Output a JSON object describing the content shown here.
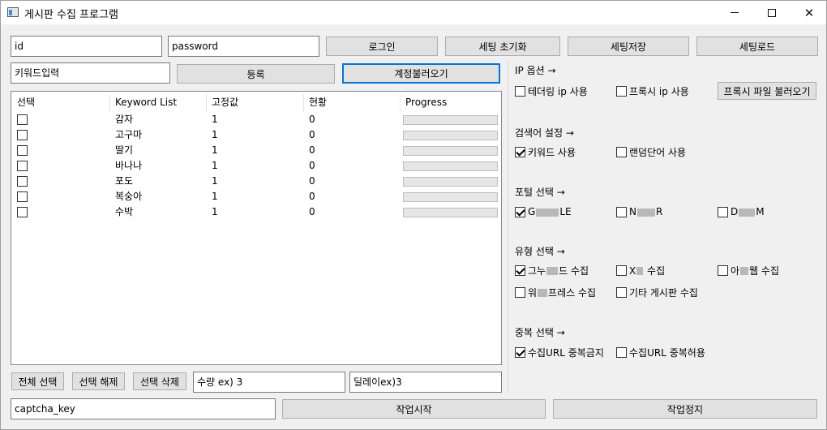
{
  "window": {
    "title": "게시판 수집 프로그램"
  },
  "login": {
    "id_value": "id",
    "password_value": "password",
    "login_label": "로그인",
    "reset_label": "세팅 초기화",
    "save_label": "세팅저장",
    "load_label": "세팅로드"
  },
  "keyword": {
    "input_value": "키워드입력",
    "register_label": "등록",
    "load_accounts_label": "계정불러오기"
  },
  "table": {
    "columns": [
      "선택",
      "Keyword List",
      "고정값",
      "현황",
      "Progress"
    ],
    "rows": [
      {
        "checked": false,
        "keyword": "감자",
        "fixed": "1",
        "status": "0",
        "progress": 0
      },
      {
        "checked": false,
        "keyword": "고구마",
        "fixed": "1",
        "status": "0",
        "progress": 0
      },
      {
        "checked": false,
        "keyword": "딸기",
        "fixed": "1",
        "status": "0",
        "progress": 0
      },
      {
        "checked": false,
        "keyword": "바나나",
        "fixed": "1",
        "status": "0",
        "progress": 0
      },
      {
        "checked": false,
        "keyword": "포도",
        "fixed": "1",
        "status": "0",
        "progress": 0
      },
      {
        "checked": false,
        "keyword": "복숭아",
        "fixed": "1",
        "status": "0",
        "progress": 0
      },
      {
        "checked": false,
        "keyword": "수박",
        "fixed": "1",
        "status": "0",
        "progress": 0
      }
    ]
  },
  "bottom": {
    "select_all_label": "전체 선택",
    "deselect_label": "선택 해제",
    "delete_selected_label": "선택 삭제",
    "quantity_value": "수량 ex) 3",
    "delay_value": "딜레이ex)3",
    "captcha_value": "captcha_key",
    "start_label": "작업시작",
    "stop_label": "작업정지"
  },
  "options": {
    "ip": {
      "title": "IP 옵션 →",
      "tethering": {
        "label": "테더링 ip 사용",
        "checked": false
      },
      "proxy": {
        "label": "프록시 ip 사용",
        "checked": false
      },
      "load_proxy_label": "프록시 파일 불러오기"
    },
    "search": {
      "title": "검색어 설정 →",
      "keyword": {
        "label": "키워드 사용",
        "checked": true
      },
      "random": {
        "label": "랜덤단어 사용",
        "checked": false
      }
    },
    "portal": {
      "title": "포털 선택 →",
      "google": {
        "label_a": "G",
        "label_b": "LE",
        "checked": true
      },
      "naver": {
        "label_a": "N",
        "label_b": "R",
        "checked": false
      },
      "daum": {
        "label_a": "D",
        "label_b": "M",
        "checked": false
      }
    },
    "type": {
      "title": "유형 선택 →",
      "gnuboard": {
        "label_a": "그누",
        "label_b": "드 수집",
        "checked": true
      },
      "xe": {
        "label_a": "X",
        "label_b": " 수집",
        "checked": false
      },
      "a_web": {
        "label_a": "아",
        "label_b": "웹 수집",
        "checked": false
      },
      "wordpress": {
        "label_a": "워",
        "label_b": "프레스 수집",
        "checked": false
      },
      "other": {
        "label": "기타 게시판 수집",
        "checked": false
      }
    },
    "dup": {
      "title": "중복 선택 →",
      "no_dup": {
        "label": "수집URL 중복금지",
        "checked": true
      },
      "allow_dup": {
        "label": "수집URL 중복허용",
        "checked": false
      }
    }
  }
}
